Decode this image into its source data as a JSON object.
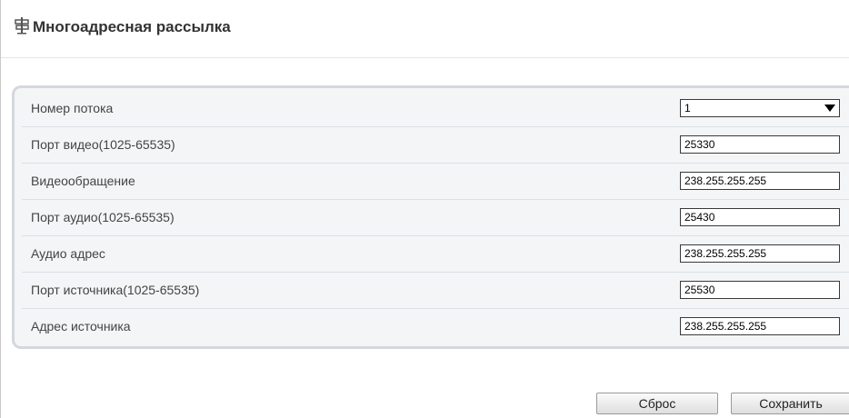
{
  "header": {
    "icon": "signpost-icon",
    "title": "Многоадресная рассылка"
  },
  "rows": [
    {
      "label": "Номер потока",
      "value": "1",
      "control": "select"
    },
    {
      "label": "Порт видео(1025-65535)",
      "value": "25330",
      "control": "input"
    },
    {
      "label": "Видеообращение",
      "value": "238.255.255.255",
      "control": "input"
    },
    {
      "label": "Порт аудио(1025-65535)",
      "value": "25430",
      "control": "input"
    },
    {
      "label": "Аудио адрес",
      "value": "238.255.255.255",
      "control": "input"
    },
    {
      "label": "Порт источника(1025-65535)",
      "value": "25530",
      "control": "input"
    },
    {
      "label": "Адрес источника",
      "value": "238.255.255.255",
      "control": "input"
    }
  ],
  "buttons": {
    "reset_label": "Сброс",
    "save_label": "Сохранить"
  },
  "colors": {
    "panel_background": "#f4f5f7",
    "panel_border": "#d3d7de"
  }
}
